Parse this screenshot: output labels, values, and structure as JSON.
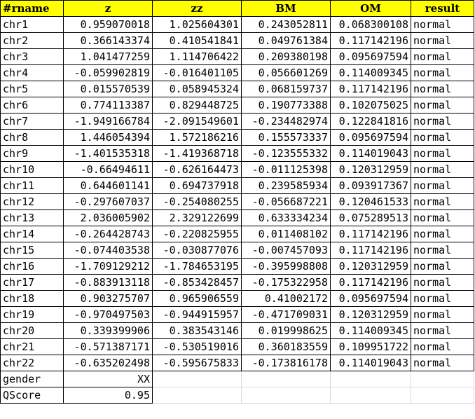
{
  "headers": [
    "#rname",
    "z",
    "zz",
    "BM",
    "OM",
    "result"
  ],
  "rows": [
    [
      "chr1",
      "0.959070018",
      "1.025604301",
      "0.243052811",
      "0.068300108",
      "normal"
    ],
    [
      "chr2",
      "0.366143374",
      "0.410541841",
      "0.049761384",
      "0.117142196",
      "normal"
    ],
    [
      "chr3",
      "1.041477259",
      "1.114706422",
      "0.209380198",
      "0.095697594",
      "normal"
    ],
    [
      "chr4",
      "-0.059902819",
      "-0.016401105",
      "0.056601269",
      "0.114009345",
      "normal"
    ],
    [
      "chr5",
      "0.015570539",
      "0.058945324",
      "0.068159737",
      "0.117142196",
      "normal"
    ],
    [
      "chr6",
      "0.774113387",
      "0.829448725",
      "0.190773388",
      "0.102075025",
      "normal"
    ],
    [
      "chr7",
      "-1.949166784",
      "-2.091549601",
      "-0.234482974",
      "0.122841816",
      "normal"
    ],
    [
      "chr8",
      "1.446054394",
      "1.572186216",
      "0.155573337",
      "0.095697594",
      "normal"
    ],
    [
      "chr9",
      "-1.401535318",
      "-1.419368718",
      "-0.123555332",
      "0.114019043",
      "normal"
    ],
    [
      "chr10",
      "-0.66494611",
      "-0.626164473",
      "-0.011125398",
      "0.120312959",
      "normal"
    ],
    [
      "chr11",
      "0.644601141",
      "0.694737918",
      "0.239585934",
      "0.093917367",
      "normal"
    ],
    [
      "chr12",
      "-0.297607037",
      "-0.254080255",
      "-0.056687221",
      "0.120461533",
      "normal"
    ],
    [
      "chr13",
      "2.036005902",
      "2.329122699",
      "0.633334234",
      "0.075289513",
      "normal"
    ],
    [
      "chr14",
      "-0.264428743",
      "-0.220825955",
      "0.011408102",
      "0.117142196",
      "normal"
    ],
    [
      "chr15",
      "-0.074403538",
      "-0.030877076",
      "-0.007457093",
      "0.117142196",
      "normal"
    ],
    [
      "chr16",
      "-1.709129212",
      "-1.784653195",
      "-0.395998808",
      "0.120312959",
      "normal"
    ],
    [
      "chr17",
      "-0.883913118",
      "-0.853428457",
      "-0.175322958",
      "0.117142196",
      "normal"
    ],
    [
      "chr18",
      "0.903275707",
      "0.965906559",
      "0.41002172",
      "0.095697594",
      "normal"
    ],
    [
      "chr19",
      "-0.970497503",
      "-0.944915957",
      "-0.471709031",
      "0.120312959",
      "normal"
    ],
    [
      "chr20",
      "0.339399906",
      "0.383543146",
      "0.019998625",
      "0.114009345",
      "normal"
    ],
    [
      "chr21",
      "-0.571387171",
      "-0.530519016",
      "0.360183559",
      "0.109951722",
      "normal"
    ],
    [
      "chr22",
      "-0.635202498",
      "-0.595675833",
      "-0.173816178",
      "0.114019043",
      "normal"
    ]
  ],
  "gender": {
    "label": "gender",
    "value": "XX"
  },
  "qscore": {
    "label": "QScore",
    "value": "0.95"
  }
}
